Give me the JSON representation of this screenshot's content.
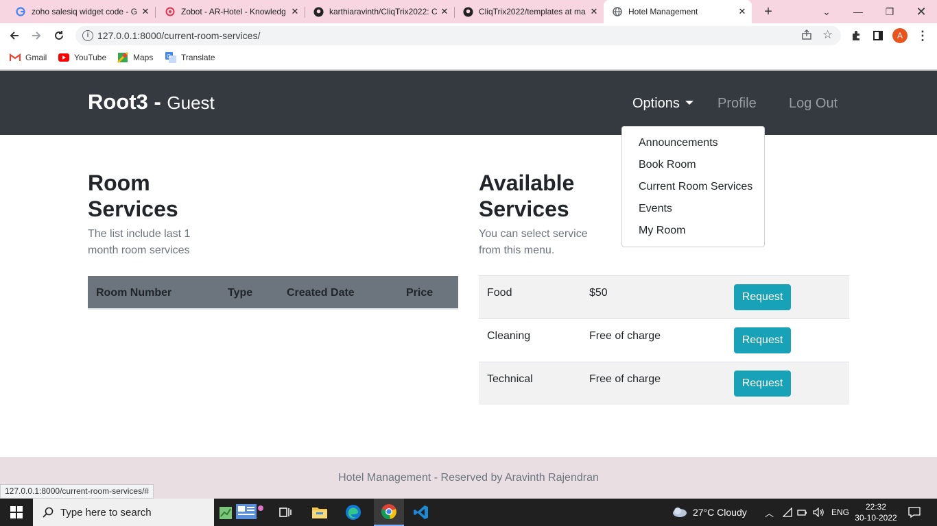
{
  "browser": {
    "tabs": [
      {
        "title": "zoho salesiq widget code - G",
        "icon": "google-icon"
      },
      {
        "title": "Zobot - AR-Hotel - Knowledg",
        "icon": "zoho-icon"
      },
      {
        "title": "karthiaravinth/CliqTrix2022: C",
        "icon": "github-icon"
      },
      {
        "title": "CliqTrix2022/templates at ma",
        "icon": "github-icon"
      },
      {
        "title": "Hotel Management",
        "icon": "globe-icon"
      }
    ],
    "new_tab": "+",
    "url": "127.0.0.1:8000/current-room-services/",
    "profile_initial": "A",
    "bookmarks": [
      {
        "label": "Gmail",
        "icon": "gmail-icon"
      },
      {
        "label": "YouTube",
        "icon": "youtube-icon"
      },
      {
        "label": "Maps",
        "icon": "maps-icon"
      },
      {
        "label": "Translate",
        "icon": "translate-icon"
      }
    ],
    "status_url": "127.0.0.1:8000/current-room-services/#"
  },
  "navbar": {
    "brand": "Root3",
    "separator": " - ",
    "role": "Guest",
    "options_label": "Options",
    "profile_label": "Profile",
    "logout_label": "Log Out",
    "dropdown": [
      "Announcements",
      "Book Room",
      "Current Room Services",
      "Events",
      "My Room"
    ]
  },
  "room_services": {
    "title_line1": "Room",
    "title_line2": "Services",
    "subtitle_line1": "The list include last 1",
    "subtitle_line2": "month room services",
    "columns": [
      "Room Number",
      "Type",
      "Created Date",
      "Price"
    ]
  },
  "available_services": {
    "title_line1": "Available",
    "title_line2": "Services",
    "subtitle_line1": "You can select service",
    "subtitle_line2": "from this menu.",
    "button_label": "Request",
    "rows": [
      {
        "name": "Food",
        "price": "$50"
      },
      {
        "name": "Cleaning",
        "price": "Free of charge"
      },
      {
        "name": "Technical",
        "price": "Free of charge"
      }
    ]
  },
  "footer": {
    "text": "Hotel Management - Reserved by Aravinth Rajendran"
  },
  "taskbar": {
    "search_placeholder": "Type here to search",
    "weather": "27°C  Cloudy",
    "language": "ENG",
    "time": "22:32",
    "date": "30-10-2022"
  },
  "colors": {
    "navbar": "#343a40",
    "accent_button": "#17a2b8",
    "table_header": "#6c757d",
    "tab_strip": "#f7d6e2"
  }
}
